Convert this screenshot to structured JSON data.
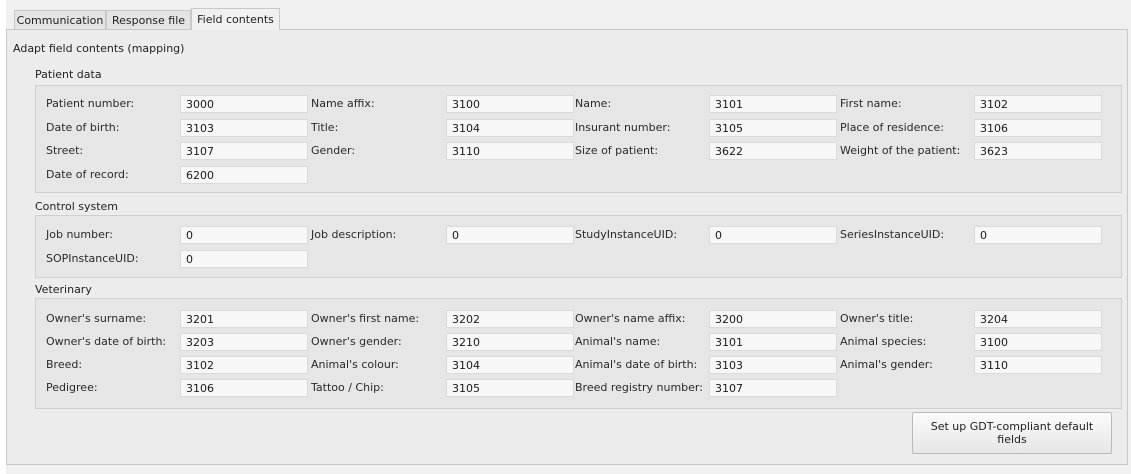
{
  "tabs": [
    {
      "label": "Communication",
      "active": false
    },
    {
      "label": "Response file",
      "active": false
    },
    {
      "label": "Field contents",
      "active": true
    }
  ],
  "section_title": "Adapt field contents (mapping)",
  "groups": {
    "patient": {
      "title": "Patient data",
      "rows": [
        [
          {
            "label": "Patient number:",
            "value": "3000"
          },
          {
            "label": "Name affix:",
            "value": "3100"
          },
          {
            "label": "Name:",
            "value": "3101"
          },
          {
            "label": "First name:",
            "value": "3102"
          }
        ],
        [
          {
            "label": "Date of birth:",
            "value": "3103"
          },
          {
            "label": "Title:",
            "value": "3104"
          },
          {
            "label": "Insurant number:",
            "value": "3105"
          },
          {
            "label": "Place of residence:",
            "value": "3106"
          }
        ],
        [
          {
            "label": "Street:",
            "value": "3107"
          },
          {
            "label": "Gender:",
            "value": "3110"
          },
          {
            "label": "Size of patient:",
            "value": "3622"
          },
          {
            "label": "Weight of the patient:",
            "value": "3623"
          }
        ],
        [
          {
            "label": "Date of record:",
            "value": "6200"
          }
        ]
      ]
    },
    "control": {
      "title": "Control system",
      "rows": [
        [
          {
            "label": "Job number:",
            "value": "0"
          },
          {
            "label": "Job description:",
            "value": "0"
          },
          {
            "label": "StudyInstanceUID:",
            "value": "0"
          },
          {
            "label": "SeriesInstanceUID:",
            "value": "0"
          }
        ],
        [
          {
            "label": "SOPInstanceUID:",
            "value": "0"
          }
        ]
      ]
    },
    "veterinary": {
      "title": "Veterinary",
      "rows": [
        [
          {
            "label": "Owner's surname:",
            "value": "3201"
          },
          {
            "label": "Owner's first name:",
            "value": "3202"
          },
          {
            "label": "Owner's name affix:",
            "value": "3200"
          },
          {
            "label": "Owner's title:",
            "value": "3204"
          }
        ],
        [
          {
            "label": "Owner's date of birth:",
            "value": "3203"
          },
          {
            "label": "Owner's gender:",
            "value": "3210"
          },
          {
            "label": "Animal's name:",
            "value": "3101"
          },
          {
            "label": "Animal species:",
            "value": "3100"
          }
        ],
        [
          {
            "label": "Breed:",
            "value": "3102"
          },
          {
            "label": "Animal's colour:",
            "value": "3104"
          },
          {
            "label": "Animal's date of birth:",
            "value": "3103"
          },
          {
            "label": "Animal's gender:",
            "value": "3110"
          }
        ],
        [
          {
            "label": "Pedigree:",
            "value": "3106"
          },
          {
            "label": "Tattoo / Chip:",
            "value": "3105"
          },
          {
            "label": "Breed registry number:",
            "value": "3107"
          }
        ]
      ]
    }
  },
  "default_button_label": "Set up GDT-compliant default fields"
}
